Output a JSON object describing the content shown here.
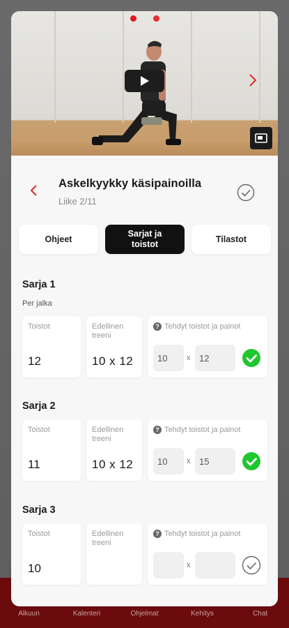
{
  "tabbar": {
    "items": [
      "Alkuun",
      "Kalenteri",
      "Ohjelmat",
      "Kehitys",
      "Chat"
    ]
  },
  "exercise": {
    "title": "Askelkyykky käsipainoilla",
    "subtitle": "Liike 2/11"
  },
  "tabs": {
    "items": [
      {
        "label": "Ohjeet",
        "active": false
      },
      {
        "label": "Sarjat ja toistot",
        "active": true
      },
      {
        "label": "Tilastot",
        "active": false
      }
    ]
  },
  "sets": [
    {
      "title": "Sarja 1",
      "note": "Per jalka",
      "reps_label": "Toistot",
      "reps": "12",
      "prev_label": "Edellinen treeni",
      "prev": "10 x 12",
      "done_label": "Tehdyt toistot ja painot",
      "done_reps": "10",
      "done_weight": "12",
      "x": "x",
      "completed": true
    },
    {
      "title": "Sarja 2",
      "note": "",
      "reps_label": "Toistot",
      "reps": "11",
      "prev_label": "Edellinen treeni",
      "prev": "10 x 12",
      "done_label": "Tehdyt toistot ja painot",
      "done_reps": "10",
      "done_weight": "15",
      "x": "x",
      "completed": true
    },
    {
      "title": "Sarja 3",
      "note": "",
      "reps_label": "Toistot",
      "reps": "10",
      "prev_label": "Edellinen treeni",
      "prev": "",
      "done_label": "Tehdyt toistot ja painot",
      "done_reps": "",
      "done_weight": "",
      "x": "x",
      "completed": false
    }
  ],
  "colors": {
    "accent": "#e0272b",
    "success": "#1ec72e",
    "tabbar": "#6b0b0d"
  },
  "icons": {
    "back": "chevron-left-icon",
    "next": "chevron-right-icon",
    "play": "play-icon",
    "pip": "picture-in-picture-icon",
    "done": "check-circle-icon"
  }
}
